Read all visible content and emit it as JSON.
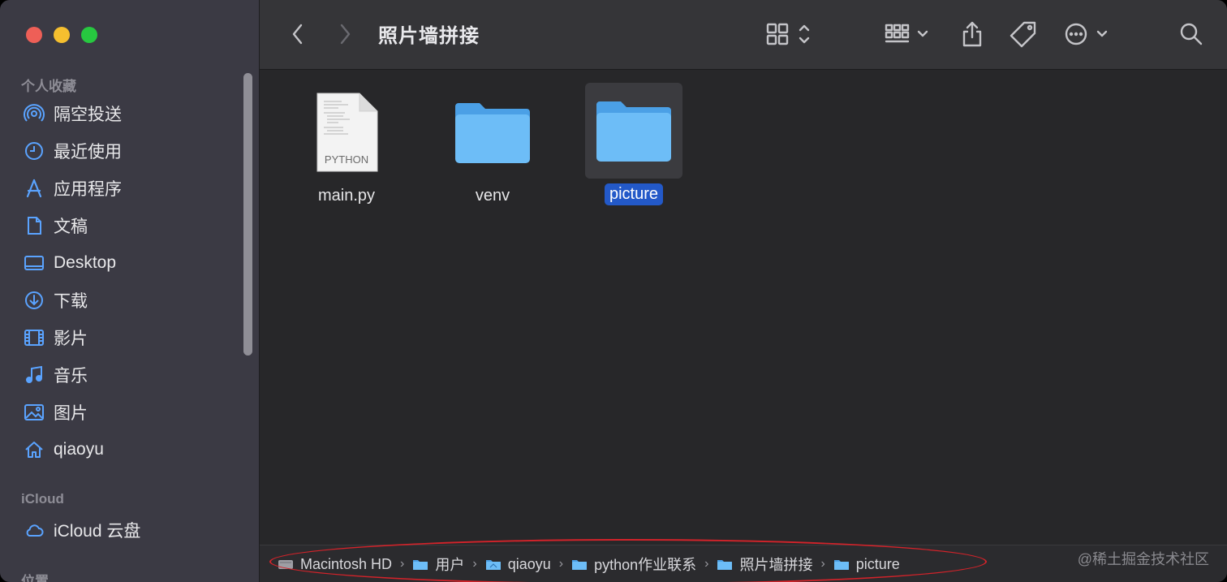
{
  "window": {
    "title": "照片墙拼接"
  },
  "sidebar": {
    "favorites_title": "个人收藏",
    "favorites": [
      {
        "label": "隔空投送",
        "icon": "airdrop-icon"
      },
      {
        "label": "最近使用",
        "icon": "clock-icon"
      },
      {
        "label": "应用程序",
        "icon": "applications-icon"
      },
      {
        "label": "文稿",
        "icon": "document-icon"
      },
      {
        "label": "Desktop",
        "icon": "desktop-icon"
      },
      {
        "label": "下载",
        "icon": "download-icon"
      },
      {
        "label": "影片",
        "icon": "film-icon"
      },
      {
        "label": "音乐",
        "icon": "music-icon"
      },
      {
        "label": "图片",
        "icon": "photo-icon"
      },
      {
        "label": "qiaoyu",
        "icon": "home-icon"
      }
    ],
    "icloud_title": "iCloud",
    "icloud": [
      {
        "label": "iCloud 云盘",
        "icon": "cloud-icon"
      }
    ],
    "locations_title": "位置"
  },
  "files": [
    {
      "name": "main.py",
      "kind": "python",
      "badge": "PYTHON",
      "selected": false
    },
    {
      "name": "venv",
      "kind": "folder",
      "selected": false
    },
    {
      "name": "picture",
      "kind": "folder",
      "selected": true
    }
  ],
  "pathbar": {
    "crumbs": [
      "Macintosh HD",
      "用户",
      "qiaoyu",
      "python作业联系",
      "照片墙拼接",
      "picture"
    ]
  },
  "watermark": "@稀土掘金技术社区",
  "colors": {
    "accent": "#2359c8",
    "folder": "#64b5f6",
    "annotation_ring": "#d3232a"
  }
}
